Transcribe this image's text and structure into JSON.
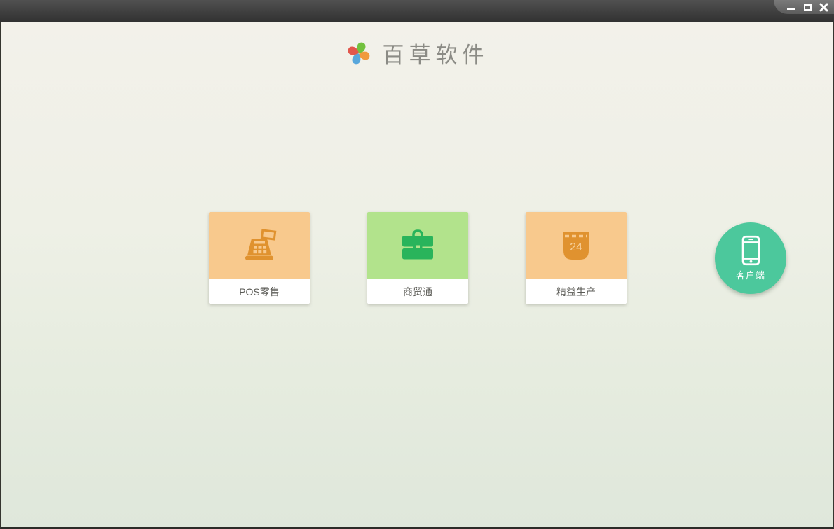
{
  "window": {
    "controls": [
      {
        "name": "minimize"
      },
      {
        "name": "maximize"
      },
      {
        "name": "close"
      }
    ]
  },
  "header": {
    "app_name": "百草软件",
    "logo": "pinwheel-logo"
  },
  "products": [
    {
      "label": "POS零售",
      "icon": "cash-register-icon",
      "bg_color": "#f8c98d",
      "icon_color": "#e0922f"
    },
    {
      "label": "商贸通",
      "icon": "briefcase-icon",
      "bg_color": "#b2e38c",
      "icon_color": "#29b45b"
    },
    {
      "label": "精益生产",
      "icon": "calendar-icon",
      "calendar_day": "24",
      "bg_color": "#f8c98d",
      "icon_color": "#e0922f"
    }
  ],
  "client_button": {
    "label": "客户端",
    "icon": "smartphone-icon",
    "bg_color": "#4cc89c"
  },
  "colors": {
    "titlebar_top": "#515151",
    "titlebar_bottom": "#323232",
    "background_top": "#f3f1ea",
    "background_bottom": "#dfe7db",
    "brand_text": "#8b8b85",
    "card_label_text": "#5a5a55",
    "logo_green": "#72c13e",
    "logo_orange": "#f09a3e",
    "logo_blue": "#58a7dc",
    "logo_red": "#e2574c"
  }
}
